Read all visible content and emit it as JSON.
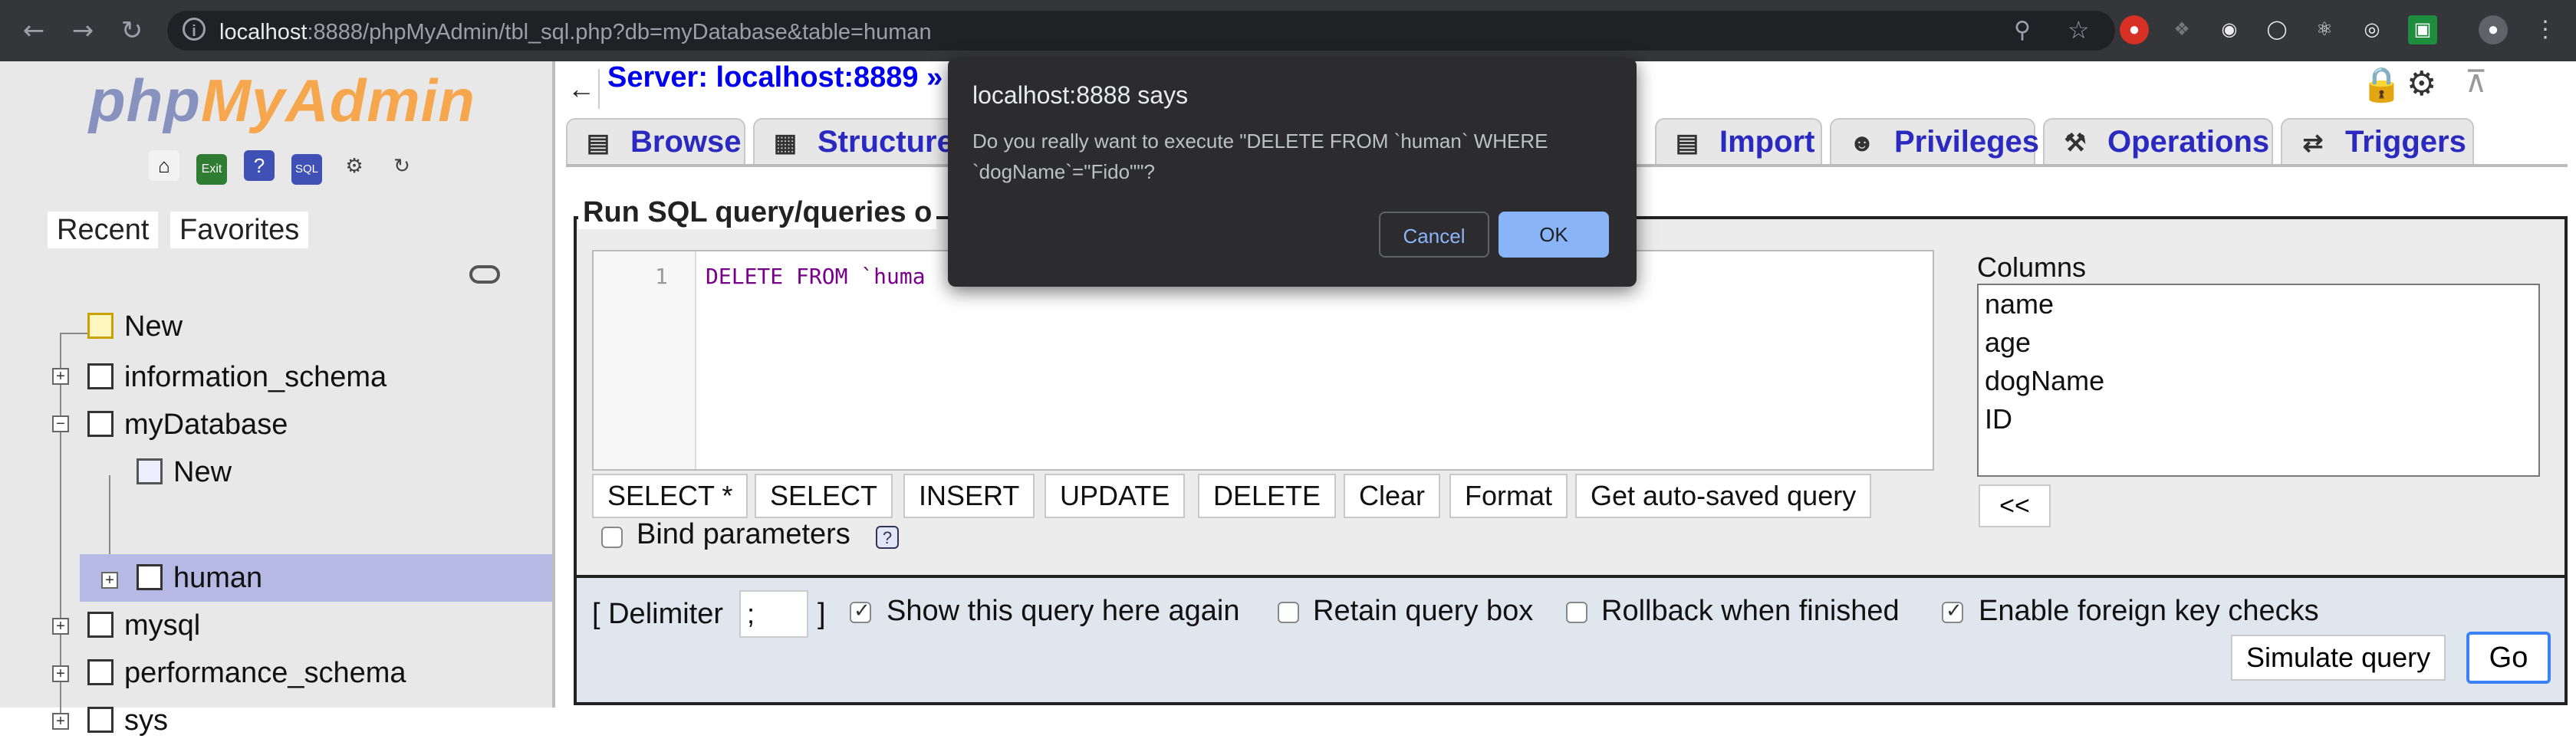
{
  "browser": {
    "url_host": "localhost",
    "url_rest": ":8888/phpMyAdmin/tbl_sql.php?db=myDatabase&table=human",
    "back_icon": "←",
    "forward_icon": "→",
    "reload_icon": "↻"
  },
  "sidebar": {
    "logo_php": "php",
    "logo_my": "My",
    "logo_admin": "Admin",
    "recent_label": "Recent",
    "favorites_label": "Favorites",
    "tree": [
      {
        "label": "New"
      },
      {
        "label": "information_schema"
      },
      {
        "label": "myDatabase"
      },
      {
        "label": "New"
      },
      {
        "label": "human"
      },
      {
        "label": "mysql"
      },
      {
        "label": "performance_schema"
      },
      {
        "label": "sys"
      }
    ]
  },
  "main": {
    "breadcrumb": "Server: localhost:8889 »",
    "tabs": [
      {
        "label": "Browse"
      },
      {
        "label": "Structure"
      },
      {
        "label": "Import"
      },
      {
        "label": "Privileges"
      },
      {
        "label": "Operations"
      },
      {
        "label": "Triggers"
      }
    ],
    "legend": "Run SQL query/queries o",
    "editor": {
      "line_number": "1",
      "code": "DELETE FROM `huma"
    },
    "query_buttons": [
      "SELECT *",
      "SELECT",
      "INSERT",
      "UPDATE",
      "DELETE",
      "Clear",
      "Format",
      "Get auto-saved query"
    ],
    "bind_parameters_label": "Bind parameters",
    "columns_title": "Columns",
    "columns": [
      "name",
      "age",
      "dogName",
      "ID"
    ],
    "insert_column_button": "<<",
    "options": {
      "delimiter_open": "[ Delimiter",
      "delimiter_value": ";",
      "delimiter_close": "]",
      "show_query_again": {
        "label": "Show this query here again",
        "checked": true
      },
      "retain_query_box": {
        "label": "Retain query box",
        "checked": false
      },
      "rollback": {
        "label": "Rollback when finished",
        "checked": false
      },
      "foreign_key": {
        "label": "Enable foreign key checks",
        "checked": true
      }
    },
    "simulate_button": "Simulate query",
    "go_button": "Go"
  },
  "dialog": {
    "title": "localhost:8888 says",
    "message": "Do you really want to execute \"DELETE FROM `human` WHERE `dogName`=\"Fido\"\"?",
    "cancel_label": "Cancel",
    "ok_label": "OK"
  },
  "colors": {
    "chrome_bg": "#35363a",
    "link_blue": "#0000ee",
    "selected_row": "#b5b9e4",
    "dialog_bg": "#2c2c2e",
    "dialog_ok": "#8ab4f8"
  }
}
